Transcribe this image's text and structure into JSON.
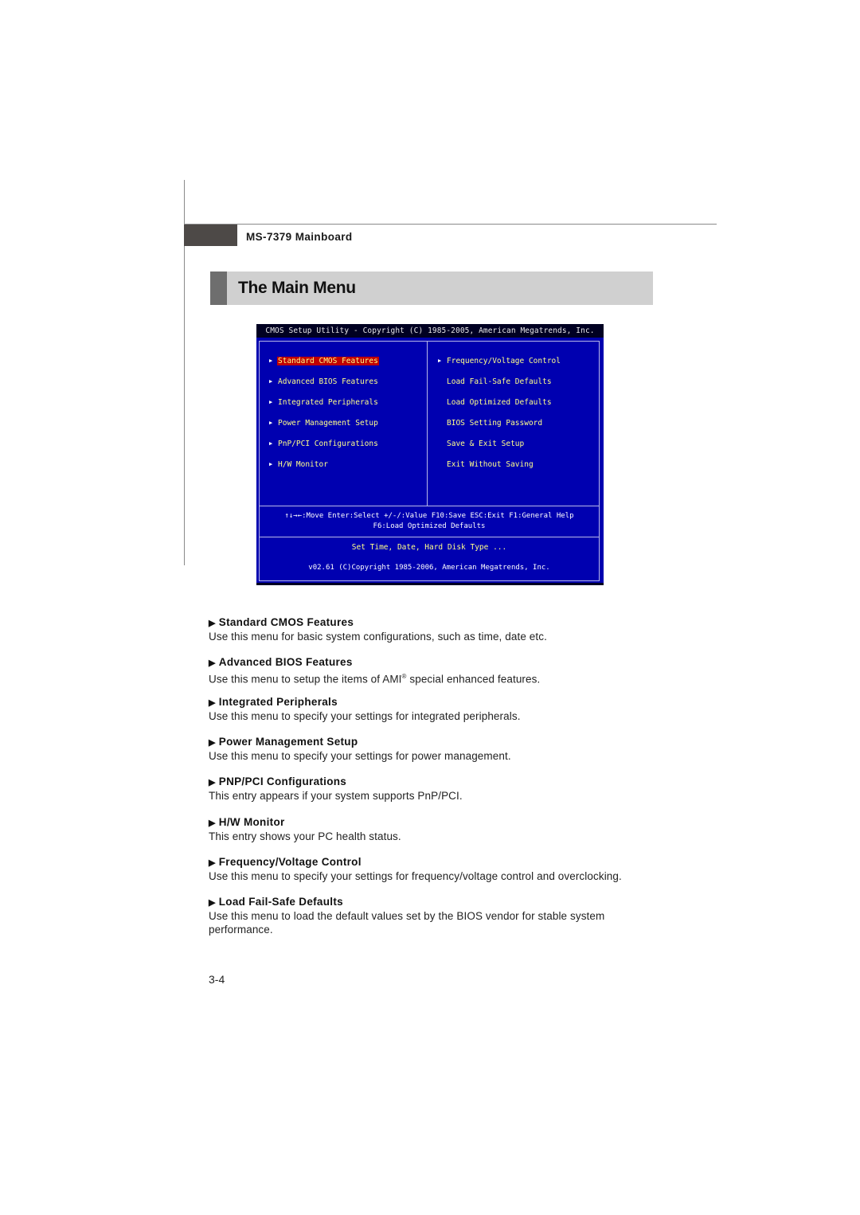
{
  "header": {
    "board_title": "MS-7379 Mainboard"
  },
  "section": {
    "title": "The Main Menu"
  },
  "bios_screen": {
    "title_bar": "CMOS Setup Utility - Copyright (C) 1985-2005, American Megatrends, Inc.",
    "left_menu": [
      {
        "label": "Standard CMOS Features",
        "has_submenu": true,
        "selected": true
      },
      {
        "label": "Advanced BIOS Features",
        "has_submenu": true,
        "selected": false
      },
      {
        "label": "Integrated Peripherals",
        "has_submenu": true,
        "selected": false
      },
      {
        "label": "Power Management Setup",
        "has_submenu": true,
        "selected": false
      },
      {
        "label": "PnP/PCI Configurations",
        "has_submenu": true,
        "selected": false
      },
      {
        "label": "H/W Monitor",
        "has_submenu": true,
        "selected": false
      }
    ],
    "right_menu": [
      {
        "label": "Frequency/Voltage Control",
        "has_submenu": true
      },
      {
        "label": "Load Fail-Safe Defaults",
        "has_submenu": false
      },
      {
        "label": "Load Optimized Defaults",
        "has_submenu": false
      },
      {
        "label": "BIOS Setting Password",
        "has_submenu": false
      },
      {
        "label": "Save & Exit Setup",
        "has_submenu": false
      },
      {
        "label": "Exit Without Saving",
        "has_submenu": false
      }
    ],
    "help_line1": "↑↓→←:Move  Enter:Select  +/-/:Value  F10:Save  ESC:Exit  F1:General Help",
    "help_line2": "F6:Load Optimized Defaults",
    "item_description": "Set Time, Date, Hard Disk Type ...",
    "version_line": "v02.61 (C)Copyright 1985-2006, American Megatrends, Inc.",
    "colors": {
      "background": "#0000b0",
      "menu_text": "#ffff8a",
      "highlight": "#c00000",
      "title_bar": "#000022"
    }
  },
  "entries": [
    {
      "title": "Standard CMOS Features",
      "text": "Use this menu for basic system configurations, such as time, date etc."
    },
    {
      "title": "Advanced BIOS Features",
      "text_before": "Use this menu to setup the items of AMI",
      "superscript": "®",
      "text_after": " special enhanced features."
    },
    {
      "title": "Integrated Peripherals",
      "text": "Use this menu to specify your settings for integrated peripherals."
    },
    {
      "title": "Power Management Setup",
      "text": "Use this menu to specify your settings for power management."
    },
    {
      "title": "PNP/PCI Configurations",
      "text": "This entry appears if your system supports PnP/PCI."
    },
    {
      "title": "H/W Monitor",
      "text": "This entry shows your PC health status."
    },
    {
      "title": "Frequency/Voltage Control",
      "text": "Use this menu to specify your settings for frequency/voltage control and overclocking."
    },
    {
      "title": "Load Fail-Safe Defaults",
      "text": "Use this menu to load the default values set by the BIOS vendor for stable system performance."
    }
  ],
  "entry_marker": "▶",
  "submenu_marker": "▶",
  "page_number": "3-4"
}
